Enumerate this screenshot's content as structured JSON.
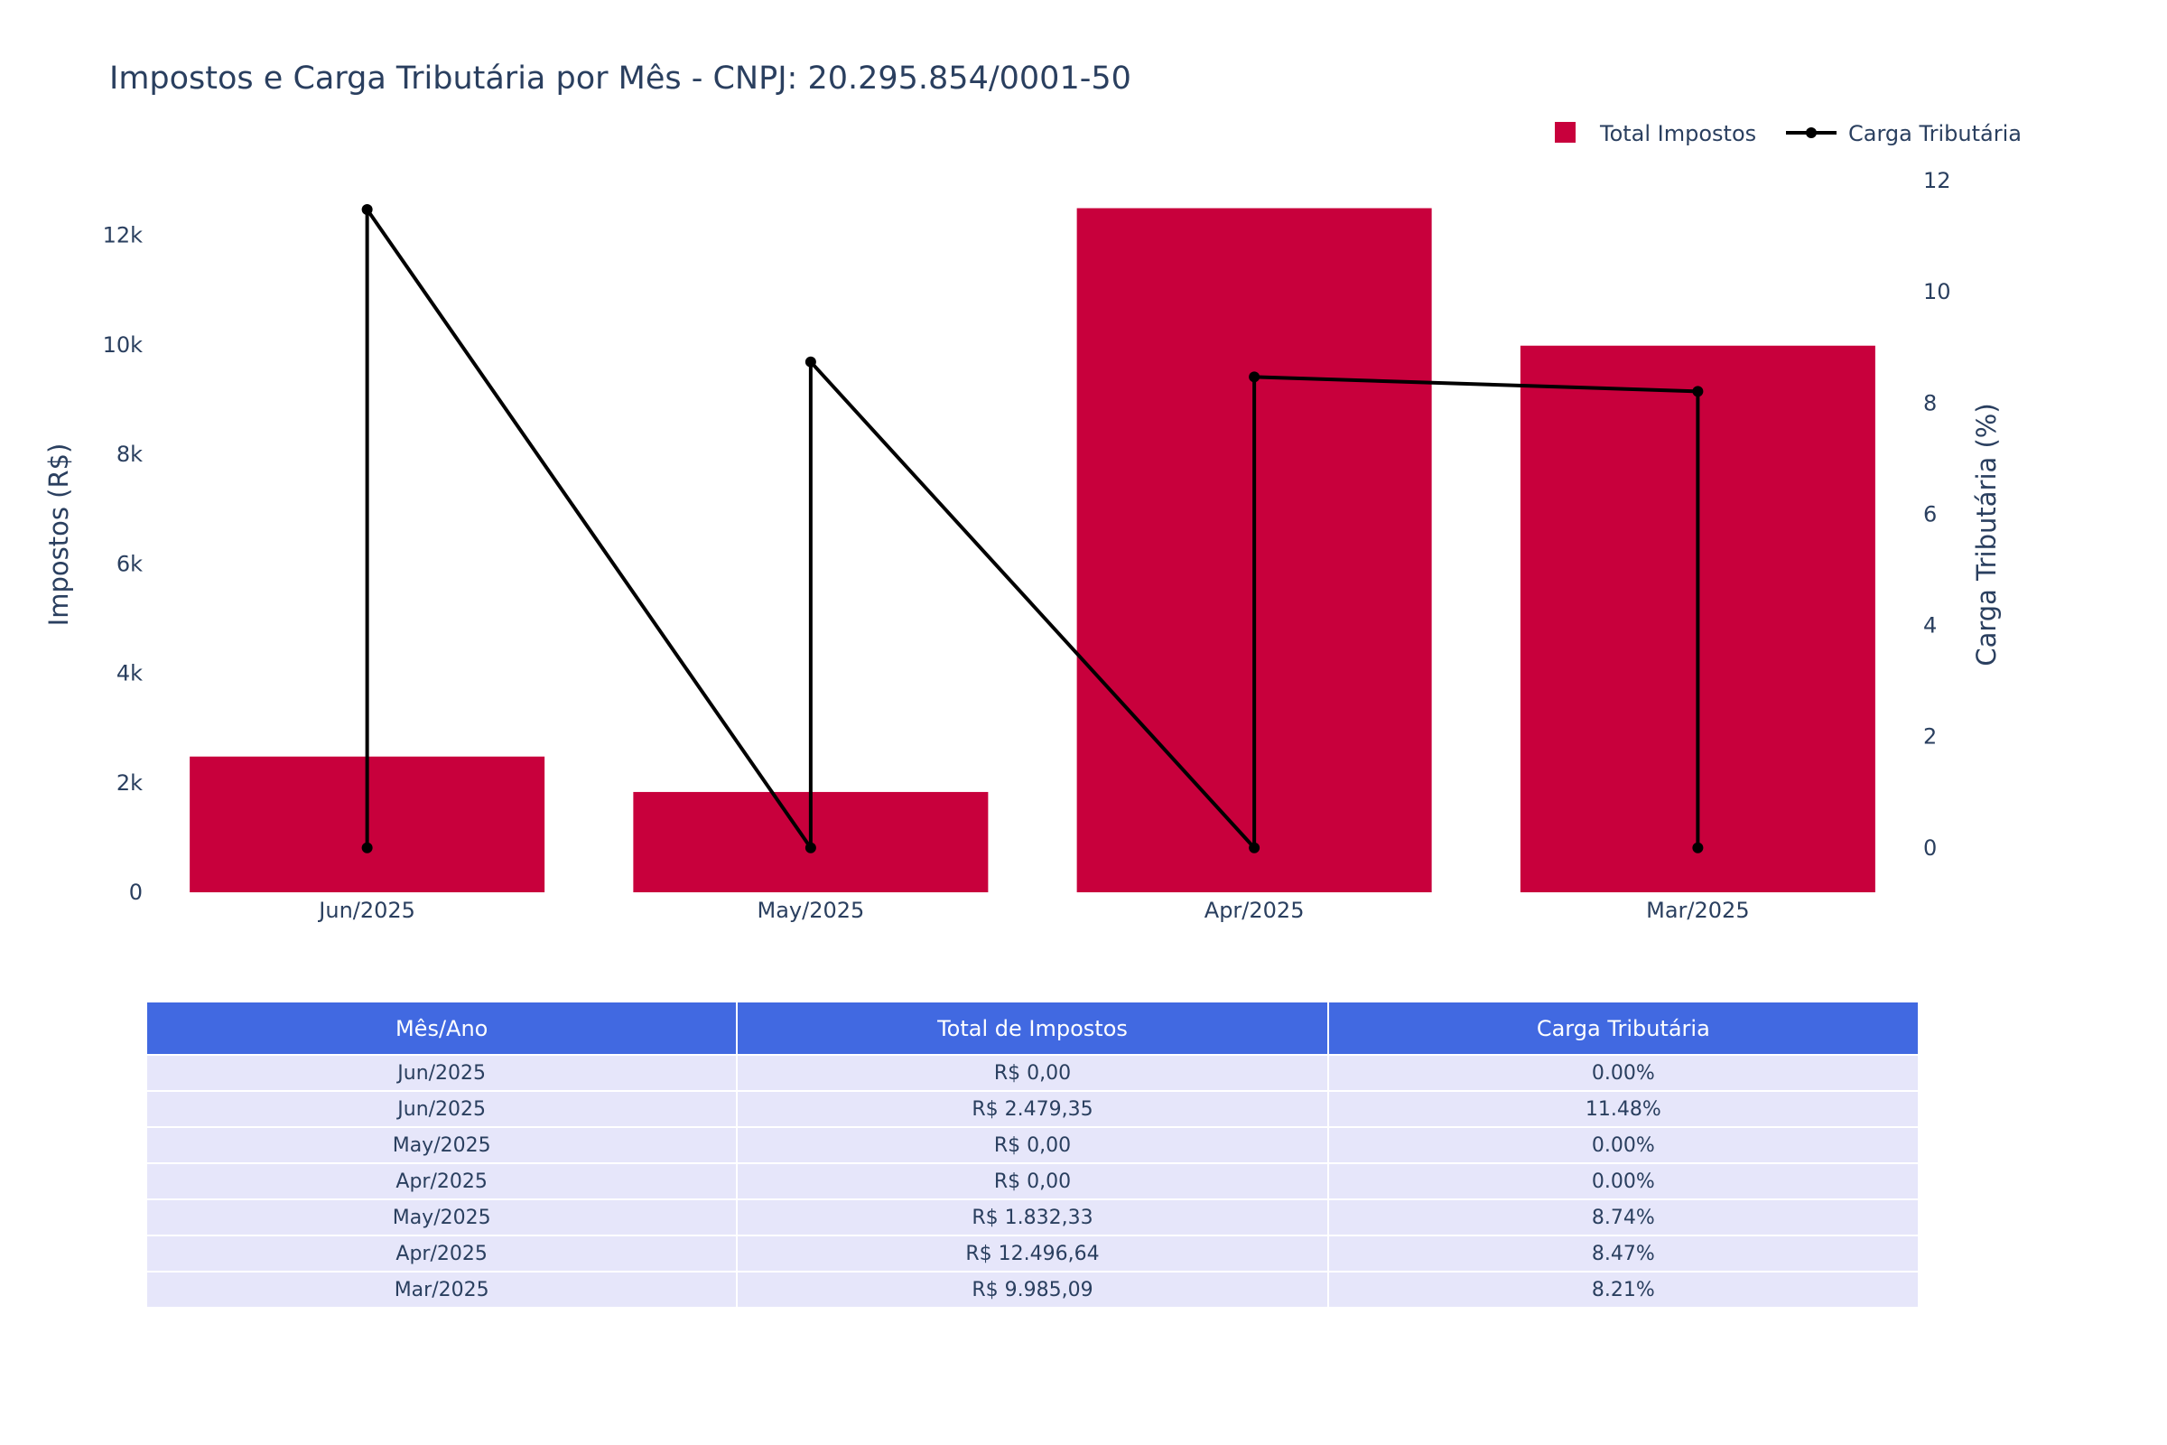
{
  "chart_data": {
    "type": "bar",
    "title": "Impostos e Carga Tributária por Mês - CNPJ: 20.295.854/0001-50",
    "categories": [
      "Jun/2025",
      "May/2025",
      "Apr/2025",
      "Mar/2025"
    ],
    "bar_series": {
      "name": "Total Impostos",
      "values": [
        2479.35,
        1832.33,
        12496.64,
        9985.09
      ],
      "color": "#c8003c"
    },
    "line_series": {
      "name": "Carga Tributária",
      "x": [
        "Jun/2025",
        "Jun/2025",
        "May/2025",
        "May/2025",
        "Apr/2025",
        "Apr/2025",
        "Mar/2025",
        "Mar/2025"
      ],
      "values": [
        0,
        11.48,
        0,
        8.74,
        0,
        8.47,
        8.21,
        0
      ],
      "color": "#000000"
    },
    "y_left": {
      "label": "Impostos (R$)",
      "range": [
        0,
        13000
      ],
      "ticks": [
        0,
        2000,
        4000,
        6000,
        8000,
        10000,
        12000
      ],
      "tick_labels": [
        "0",
        "2k",
        "4k",
        "6k",
        "8k",
        "10k",
        "12k"
      ]
    },
    "y_right": {
      "label": "Carga Tributária (%)",
      "range": [
        -0.8,
        12
      ],
      "ticks": [
        0,
        2,
        4,
        6,
        8,
        10,
        12
      ],
      "tick_labels": [
        "0",
        "2",
        "4",
        "6",
        "8",
        "10",
        "12"
      ]
    },
    "legend_position": "top-right",
    "grid": false
  },
  "table": {
    "header_color": "#4169e1",
    "cell_color": "#e6e6fa",
    "headers": [
      "Mês/Ano",
      "Total de Impostos",
      "Carga Tributária"
    ],
    "rows": [
      [
        "Jun/2025",
        "R$ 0,00",
        "0.00%"
      ],
      [
        "Jun/2025",
        "R$ 2.479,35",
        "11.48%"
      ],
      [
        "May/2025",
        "R$ 0,00",
        "0.00%"
      ],
      [
        "Apr/2025",
        "R$ 0,00",
        "0.00%"
      ],
      [
        "May/2025",
        "R$ 1.832,33",
        "8.74%"
      ],
      [
        "Apr/2025",
        "R$ 12.496,64",
        "8.47%"
      ],
      [
        "Mar/2025",
        "R$ 9.985,09",
        "8.21%"
      ]
    ]
  }
}
